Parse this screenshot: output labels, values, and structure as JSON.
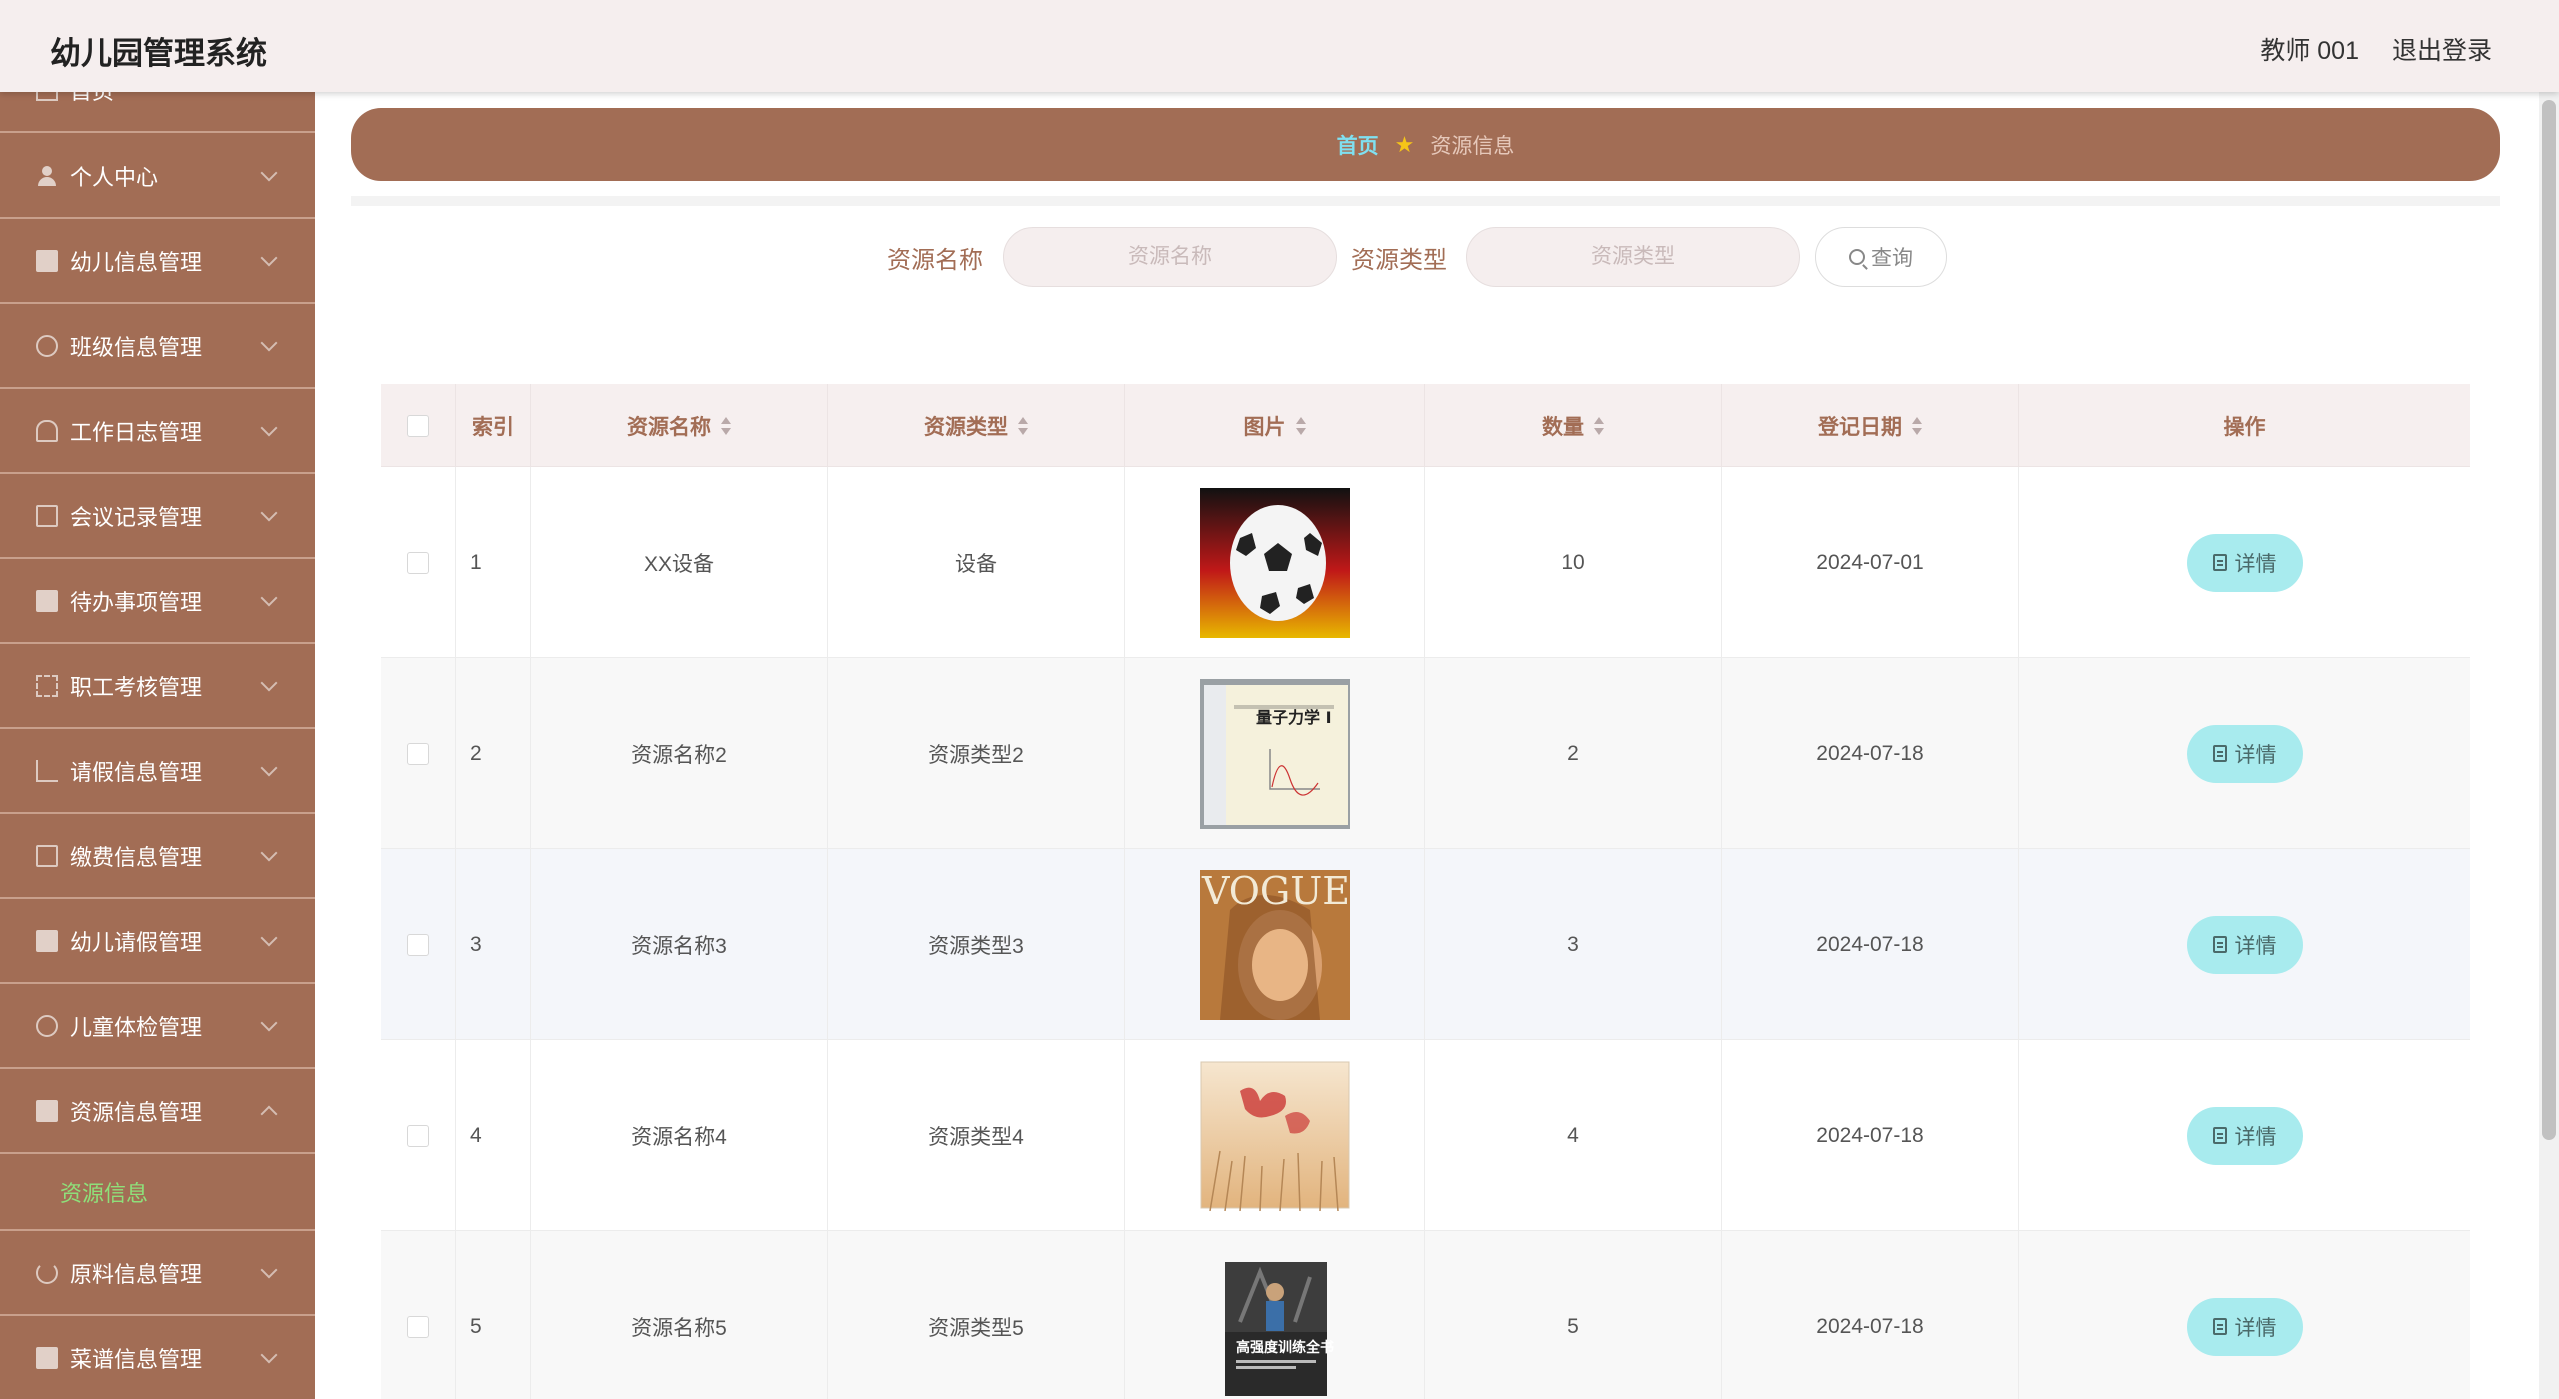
{
  "header": {
    "title": "幼儿园管理系统",
    "user": "教师 001",
    "logout": "退出登录"
  },
  "sidebar": {
    "items": [
      {
        "label": "首页",
        "icon": "home-icon"
      },
      {
        "label": "个人中心",
        "icon": "user-icon"
      },
      {
        "label": "幼儿信息管理",
        "icon": "clipboard-icon"
      },
      {
        "label": "班级信息管理",
        "icon": "clock-icon"
      },
      {
        "label": "工作日志管理",
        "icon": "bell-icon"
      },
      {
        "label": "会议记录管理",
        "icon": "mail-icon"
      },
      {
        "label": "待办事项管理",
        "icon": "checkbox-icon"
      },
      {
        "label": "职工考核管理",
        "icon": "frame-icon"
      },
      {
        "label": "请假信息管理",
        "icon": "chart-icon"
      },
      {
        "label": "缴费信息管理",
        "icon": "copy-icon"
      },
      {
        "label": "幼儿请假管理",
        "icon": "clipboard-icon"
      },
      {
        "label": "儿童体检管理",
        "icon": "globe-icon"
      },
      {
        "label": "资源信息管理",
        "icon": "monitor-icon"
      },
      {
        "label": "原料信息管理",
        "icon": "power-icon"
      },
      {
        "label": "菜谱信息管理",
        "icon": "monitor-icon"
      }
    ],
    "active_sub": "资源信息"
  },
  "breadcrumb": {
    "home": "首页",
    "current": "资源信息"
  },
  "search": {
    "name_label": "资源名称",
    "name_placeholder": "资源名称",
    "type_label": "资源类型",
    "type_placeholder": "资源类型",
    "button": "查询"
  },
  "table": {
    "columns": [
      "索引",
      "资源名称",
      "资源类型",
      "图片",
      "数量",
      "登记日期",
      "操作"
    ],
    "rows": [
      {
        "index": "1",
        "name": "XX设备",
        "type": "设备",
        "image": "soccer-ball-image",
        "qty": "10",
        "date": "2024-07-01",
        "action": "详情"
      },
      {
        "index": "2",
        "name": "资源名称2",
        "type": "资源类型2",
        "image": "quantum-mechanics-book-image",
        "qty": "2",
        "date": "2024-07-18",
        "action": "详情"
      },
      {
        "index": "3",
        "name": "资源名称3",
        "type": "资源类型3",
        "image": "vogue-magazine-image",
        "qty": "3",
        "date": "2024-07-18",
        "action": "详情"
      },
      {
        "index": "4",
        "name": "资源名称4",
        "type": "资源类型4",
        "image": "flower-book-image",
        "qty": "4",
        "date": "2024-07-18",
        "action": "详情"
      },
      {
        "index": "5",
        "name": "资源名称5",
        "type": "资源类型5",
        "image": "training-book-image",
        "qty": "5",
        "date": "2024-07-18",
        "action": "详情"
      }
    ]
  },
  "thumbs": {
    "book2_title": "量子力学 I",
    "magazine_title": "VOGUE",
    "book5_title": "高强度训练全书"
  },
  "colors": {
    "brand": "#a26d55",
    "header_bg": "#f5eeee",
    "accent_cyan": "#a8ebee",
    "active_green": "#8ee07a"
  }
}
